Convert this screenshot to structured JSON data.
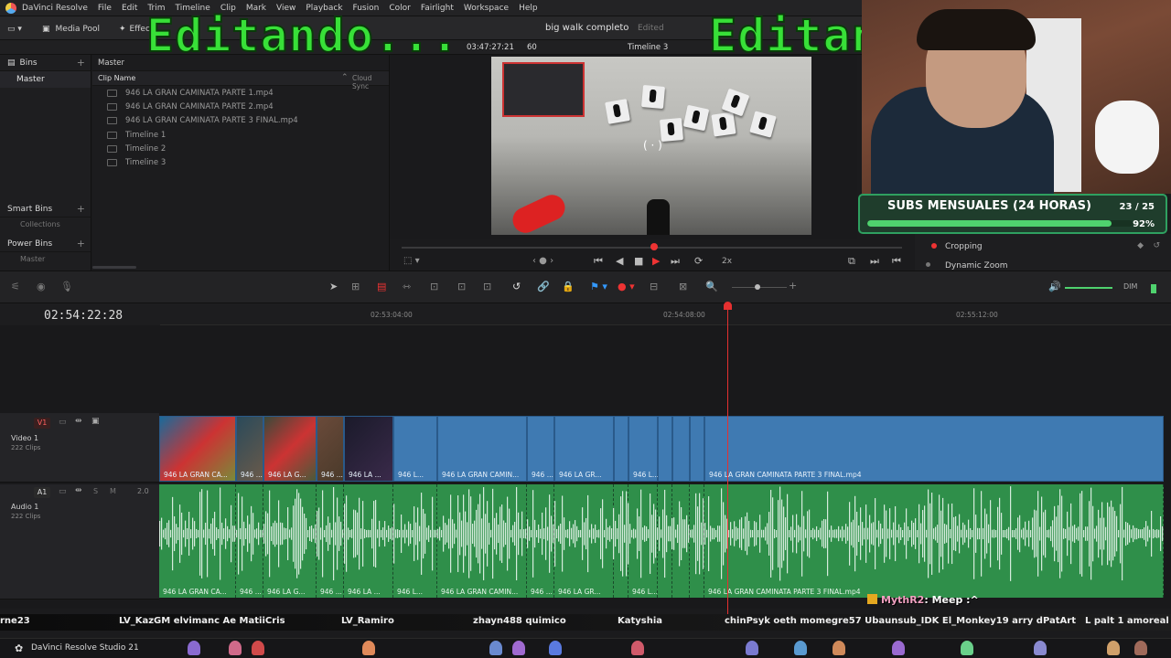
{
  "menu": [
    "DaVinci Resolve",
    "File",
    "Edit",
    "Trim",
    "Timeline",
    "Clip",
    "Mark",
    "View",
    "Playback",
    "Fusion",
    "Color",
    "Fairlight",
    "Workspace",
    "Help"
  ],
  "toolbar": {
    "media_pool": "Media Pool",
    "effects": "Effects",
    "project_title": "big walk completo",
    "edited": "Edited",
    "timecode": "03:47:27:21",
    "fps": "60",
    "timeline_name": "Timeline 3"
  },
  "overlay": {
    "left_text": "Editando...",
    "right_text": "Editan"
  },
  "bins": {
    "header": "Bins",
    "master": "Master",
    "smart_bins": "Smart Bins",
    "collections": "Collections",
    "power_bins": "Power Bins",
    "power_master": "Master"
  },
  "clips": {
    "breadcrumb": "Master",
    "col_name": "Clip Name",
    "col_cloud": "Cloud Sync",
    "items": [
      "946 LA GRAN CAMINATA PARTE 1.mp4",
      "946 LA GRAN CAMINATA PARTE 2.mp4",
      "946 LA GRAN CAMINATA PARTE 3 FINAL.mp4",
      "Timeline 1",
      "Timeline 2",
      "Timeline 3"
    ]
  },
  "subs": {
    "title": "SUBS MENSUALES (24 HORAS)",
    "count": "23 / 25",
    "percent": "92%",
    "progress": 0.92
  },
  "inspector": {
    "cropping": "Cropping",
    "dynamic_zoom": "Dynamic Zoom"
  },
  "transport": {
    "speed": "2x"
  },
  "timeline": {
    "timecode": "02:54:22:28",
    "ruler": [
      "02:53:04:00",
      "02:54:08:00",
      "02:55:12:00"
    ],
    "video_track": {
      "label": "V1",
      "name": "Video 1",
      "clips": "222 Clips"
    },
    "audio_track": {
      "label": "A1",
      "name": "Audio 1",
      "clips": "222 Clips",
      "level": "2.0"
    },
    "clip_labels": [
      "946 LA GRAN CA...",
      "946 ...",
      "946 LA G...",
      "946 ...",
      "946 LA ...",
      "946 L...",
      "946 LA GRAN CAMIN...",
      "946 ...",
      "946 LA GR...",
      "946 L...",
      "946 LA GRAN CAMINATA PARTE 3 FINAL.mp4"
    ],
    "dim": "DIM"
  },
  "stream": {
    "chat_user": "MythR2",
    "chat_msg": ": Meep :^",
    "names": [
      "rne23",
      "LV_KazGM elvimanc Ae MatiiCris",
      "LV_Ramiro",
      "zhayn488 quimico",
      "Katyshia",
      "chinPsyk oeth momegre57 Ubaunsub_IDK El_Monkey19 arry dPatArt",
      "L palt 1 amoreal"
    ],
    "taskbar_app": "DaVinci Resolve Studio 21"
  }
}
